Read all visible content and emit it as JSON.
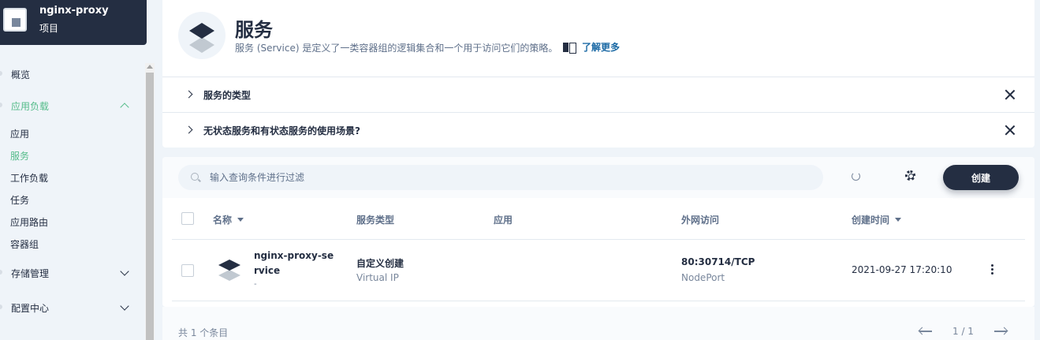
{
  "project": {
    "name": "nginx-proxy",
    "type": "项目"
  },
  "nav": {
    "overview": "概览",
    "workloads_group": "应用负载",
    "apps": "应用",
    "services": "服务",
    "workloads": "工作负载",
    "jobs": "任务",
    "routes": "应用路由",
    "pods": "容器组",
    "storage": "存储管理",
    "config": "配置中心"
  },
  "header": {
    "title": "服务",
    "description": "服务 (Service) 是定义了一类容器组的逻辑集合和一个用于访问它们的策略。",
    "learn_more": "了解更多"
  },
  "accordions": [
    {
      "label": "服务的类型"
    },
    {
      "label": "无状态服务和有状态服务的使用场景?"
    }
  ],
  "toolbar": {
    "search_placeholder": "输入查询条件进行过滤",
    "create_label": "创建"
  },
  "table": {
    "columns": [
      "名称",
      "服务类型",
      "应用",
      "外网访问",
      "创建时间"
    ],
    "rows": [
      {
        "name": "nginx-proxy-service",
        "description": "-",
        "service_type": "自定义创建",
        "service_subtype": "Virtual IP",
        "app": "",
        "external_access": "80:30714/TCP",
        "access_type": "NodePort",
        "created": "2021-09-27 17:20:10"
      }
    ]
  },
  "footer": {
    "total": "共 1 个条目",
    "page": "1 / 1"
  },
  "colors": {
    "primary_dark": "#242e42",
    "accent_green": "#55bc8a",
    "background": "#eff4f9"
  }
}
